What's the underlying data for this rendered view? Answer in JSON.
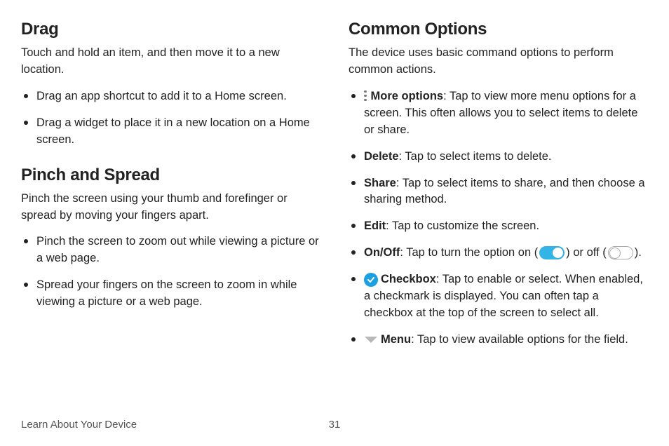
{
  "left": {
    "drag": {
      "heading": "Drag",
      "intro": "Touch and hold an item, and then move it to a new location.",
      "items": [
        "Drag an app shortcut to add it to a Home screen.",
        "Drag a widget to place it in a new location on a Home screen."
      ]
    },
    "pinch": {
      "heading": "Pinch and Spread",
      "intro": "Pinch the screen using your thumb and forefinger or spread by moving your fingers apart.",
      "items": [
        "Pinch the screen to zoom out while viewing a picture or a web page.",
        "Spread your fingers on the screen to zoom in while viewing a picture or a web page."
      ]
    }
  },
  "right": {
    "heading": "Common Options",
    "intro": "The device uses basic command options to perform common actions.",
    "options": {
      "more": {
        "label": "More options",
        "desc": ": Tap to view more menu options for a screen. This often allows you to select items to delete or share."
      },
      "delete": {
        "label": "Delete",
        "desc": ": Tap to select items to delete."
      },
      "share": {
        "label": "Share",
        "desc": ": Tap to select items to share, and then choose a sharing method."
      },
      "edit": {
        "label": "Edit",
        "desc": ": Tap to customize the screen."
      },
      "onoff": {
        "label": "On/Off",
        "pre": ": Tap to turn the option on (",
        "mid": ") or off (",
        "post": ")."
      },
      "checkbox": {
        "label": "Checkbox",
        "desc": ": Tap to enable or select. When enabled, a checkmark is displayed. You can often tap a checkbox at the top of the screen to select all."
      },
      "menu": {
        "label": "Menu",
        "desc": ": Tap to view available options for the field."
      }
    }
  },
  "footer": {
    "section": "Learn About Your Device",
    "page": "31"
  }
}
